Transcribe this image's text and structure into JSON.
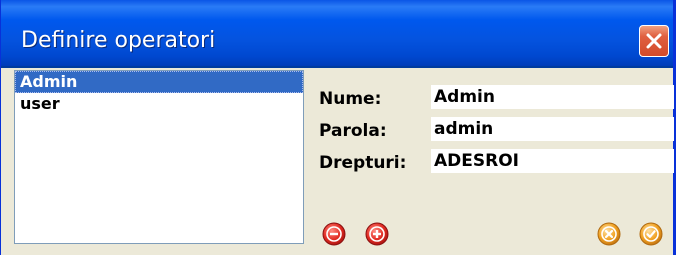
{
  "window": {
    "title": "Definire operatori"
  },
  "users": {
    "items": [
      {
        "label": "Admin",
        "selected": true
      },
      {
        "label": "user",
        "selected": false
      }
    ]
  },
  "form": {
    "name_label": "Nume:",
    "name_value": "Admin",
    "password_label": "Parola:",
    "password_value": "admin",
    "rights_label": "Drepturi:",
    "rights_value": "ADESROI"
  },
  "icons": {
    "remove": "minus-circle-icon",
    "add": "plus-circle-icon",
    "cancel": "x-circle-icon",
    "ok": "check-circle-icon"
  },
  "colors": {
    "titlebar": "#0058ee",
    "selection": "#316ac5",
    "red_button": "#d8201c",
    "orange_button": "#f0a020"
  }
}
